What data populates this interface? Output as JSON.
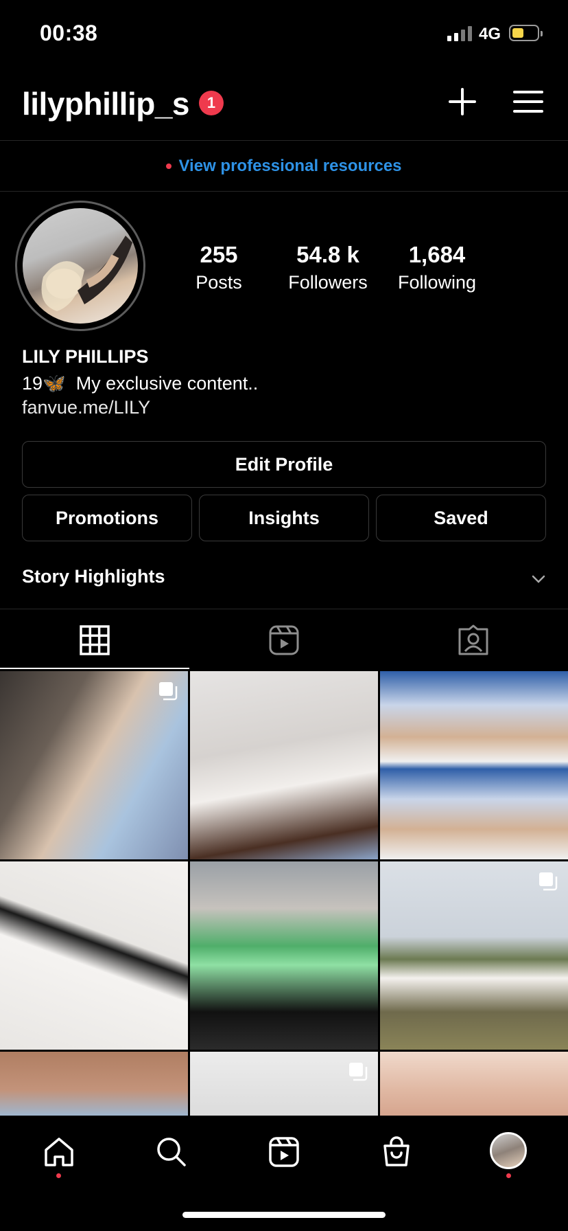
{
  "status_bar": {
    "time": "00:38",
    "network": "4G",
    "battery_level": 0.35
  },
  "header": {
    "username": "lilyphillip_s",
    "notification_count": "1",
    "icons": [
      "plus-icon",
      "menu-icon"
    ]
  },
  "professional": {
    "link_text": "View professional resources"
  },
  "profile": {
    "stats": [
      {
        "value": "255",
        "label": "Posts"
      },
      {
        "value": "54.8 k",
        "label": "Followers"
      },
      {
        "value": "1,684",
        "label": "Following"
      }
    ],
    "full_name": "LILY PHILLIPS",
    "bio_age": "19",
    "bio_emoji": "🦋",
    "bio_text": "My exclusive content..",
    "link": "fanvue.me/LILY"
  },
  "buttons": {
    "edit_profile": "Edit Profile",
    "promotions": "Promotions",
    "insights": "Insights",
    "saved": "Saved"
  },
  "highlights": {
    "label": "Story Highlights"
  },
  "tabs": [
    "grid-icon",
    "reels-icon",
    "tagged-icon"
  ],
  "grid": [
    {
      "multi": true
    },
    {
      "multi": false
    },
    {
      "multi": false
    },
    {
      "multi": false
    },
    {
      "multi": false
    },
    {
      "multi": true
    },
    {
      "multi": false
    },
    {
      "multi": true
    },
    {
      "multi": false
    }
  ],
  "colors": {
    "accent_link": "#2e92e6",
    "badge": "#ef3a4d",
    "background": "#000000"
  },
  "nav": [
    "home-icon",
    "search-icon",
    "reels-icon",
    "shop-icon",
    "profile-avatar"
  ]
}
